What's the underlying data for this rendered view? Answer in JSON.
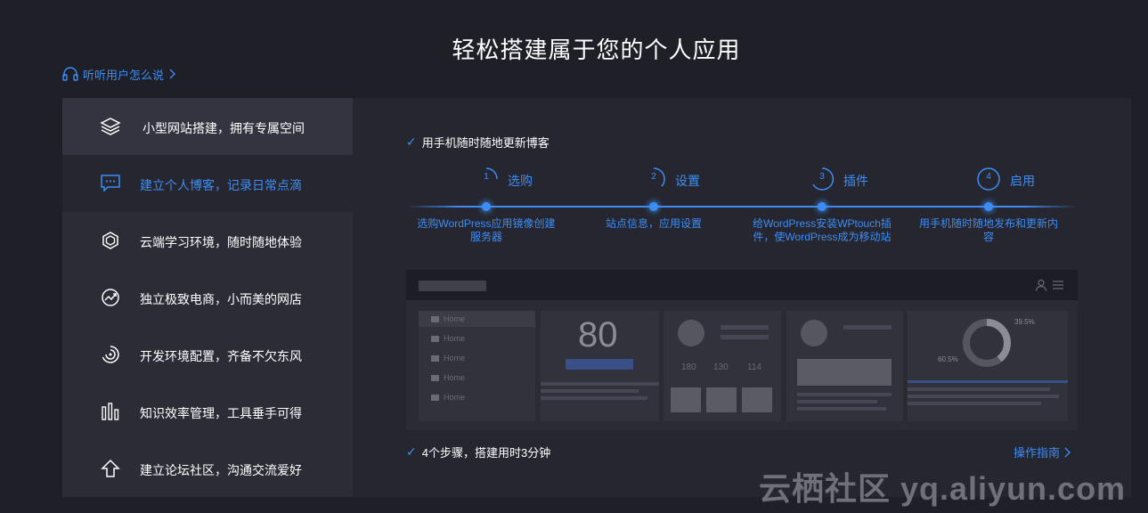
{
  "header": {
    "title": "轻松搭建属于您的个人应用",
    "listen_link": "听听用户怎么说"
  },
  "sidebar": {
    "items": [
      {
        "label": "小型网站搭建，拥有专属空间",
        "icon": "layers-icon"
      },
      {
        "label": "建立个人博客，记录日常点滴",
        "icon": "chat-icon"
      },
      {
        "label": "云端学习环境，随时随地体验",
        "icon": "hexagon-icon"
      },
      {
        "label": "独立极致电商，小而美的网店",
        "icon": "trend-icon"
      },
      {
        "label": "开发环境配置，齐备不欠东风",
        "icon": "swirl-icon"
      },
      {
        "label": "知识效率管理，工具垂手可得",
        "icon": "bars-icon"
      },
      {
        "label": "建立论坛社区，沟通交流爱好",
        "icon": "upload-icon"
      }
    ]
  },
  "main": {
    "top_check": "用手机随时随地更新博客",
    "steps": [
      {
        "num": "1",
        "name": "选购",
        "desc": "选购WordPress应用镜像创建服务器"
      },
      {
        "num": "2",
        "name": "设置",
        "desc": "站点信息，应用设置"
      },
      {
        "num": "3",
        "name": "插件",
        "desc": "给WordPress安装WPtouch插件，使WordPress成为移动站"
      },
      {
        "num": "4",
        "name": "启用",
        "desc": "用手机随时随地发布和更新内容"
      }
    ],
    "preview": {
      "menu": [
        "Home",
        "Home",
        "Home",
        "Home",
        "Home"
      ],
      "metric": "80",
      "stats": [
        "180",
        "130",
        "114"
      ],
      "donut_labels": [
        "39.5%",
        "60.5%"
      ]
    },
    "bottom_check": "4个步骤，搭建用时3分钟",
    "guide_link": "操作指南"
  },
  "watermark": "云栖社区 yq.aliyun.com",
  "colors": {
    "accent": "#3d8df5",
    "background": "#1e1f27",
    "panel": "#25262f",
    "sidebar": "#2b2c36"
  }
}
